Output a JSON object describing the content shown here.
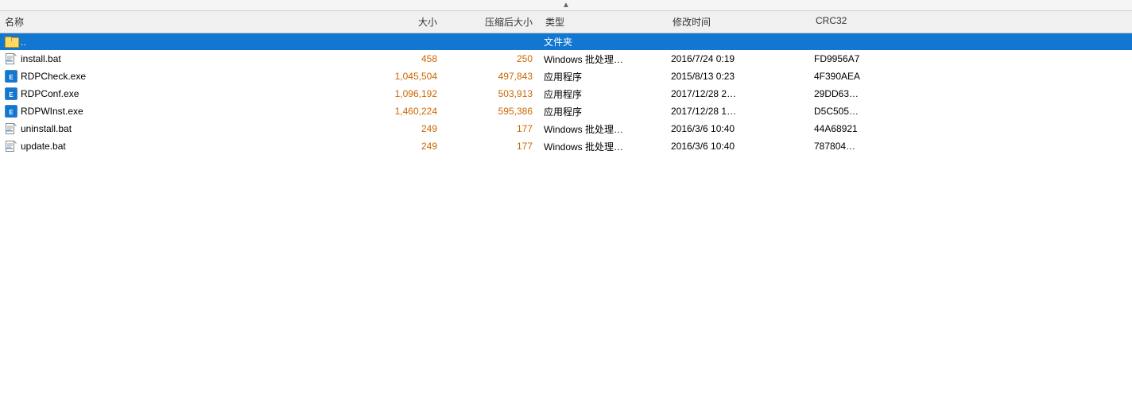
{
  "headers": {
    "name": "名称",
    "size": "大小",
    "compressed": "压缩后大小",
    "type": "类型",
    "modified": "修改时间",
    "crc": "CRC32"
  },
  "sort_arrow": "▲",
  "rows": [
    {
      "id": "row-parent",
      "icon": "folder",
      "name": "..",
      "size": "",
      "compressed": "",
      "type": "文件夹",
      "modified": "",
      "crc": "",
      "selected": true
    },
    {
      "id": "row-install-bat",
      "icon": "bat",
      "name": "install.bat",
      "size": "458",
      "compressed": "250",
      "type": "Windows 批处理…",
      "modified": "2016/7/24 0:19",
      "crc": "FD9956A7",
      "selected": false
    },
    {
      "id": "row-rdpcheck",
      "icon": "exe",
      "name": "RDPCheck.exe",
      "size": "1,045,504",
      "compressed": "497,843",
      "type": "应用程序",
      "modified": "2015/8/13 0:23",
      "crc": "4F390AEA",
      "selected": false
    },
    {
      "id": "row-rdpconf",
      "icon": "exe",
      "name": "RDPConf.exe",
      "size": "1,096,192",
      "compressed": "503,913",
      "type": "应用程序",
      "modified": "2017/12/28 2…",
      "crc": "29DD63…",
      "selected": false
    },
    {
      "id": "row-rdpwinst",
      "icon": "exe",
      "name": "RDPWInst.exe",
      "size": "1,460,224",
      "compressed": "595,386",
      "type": "应用程序",
      "modified": "2017/12/28 1…",
      "crc": "D5C505…",
      "selected": false
    },
    {
      "id": "row-uninstall",
      "icon": "bat",
      "name": "uninstall.bat",
      "size": "249",
      "compressed": "177",
      "type": "Windows 批处理…",
      "modified": "2016/3/6 10:40",
      "crc": "44A68921",
      "selected": false
    },
    {
      "id": "row-update",
      "icon": "bat",
      "name": "update.bat",
      "size": "249",
      "compressed": "177",
      "type": "Windows 批处理…",
      "modified": "2016/3/6 10:40",
      "crc": "787804…",
      "selected": false
    }
  ]
}
